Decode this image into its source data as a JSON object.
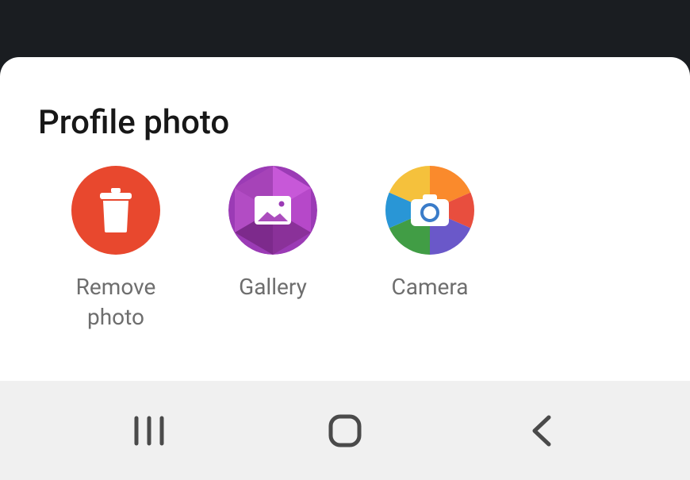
{
  "sheet": {
    "title": "Profile photo",
    "options": [
      {
        "label": "Remove photo",
        "icon": "trash-icon"
      },
      {
        "label": "Gallery",
        "icon": "gallery-icon"
      },
      {
        "label": "Camera",
        "icon": "camera-icon"
      }
    ]
  },
  "navbar": {
    "buttons": [
      "recents",
      "home",
      "back"
    ]
  },
  "colors": {
    "remove": "#e8482e",
    "gallery": "#9b3bb5",
    "camera": "#f5c13c"
  }
}
